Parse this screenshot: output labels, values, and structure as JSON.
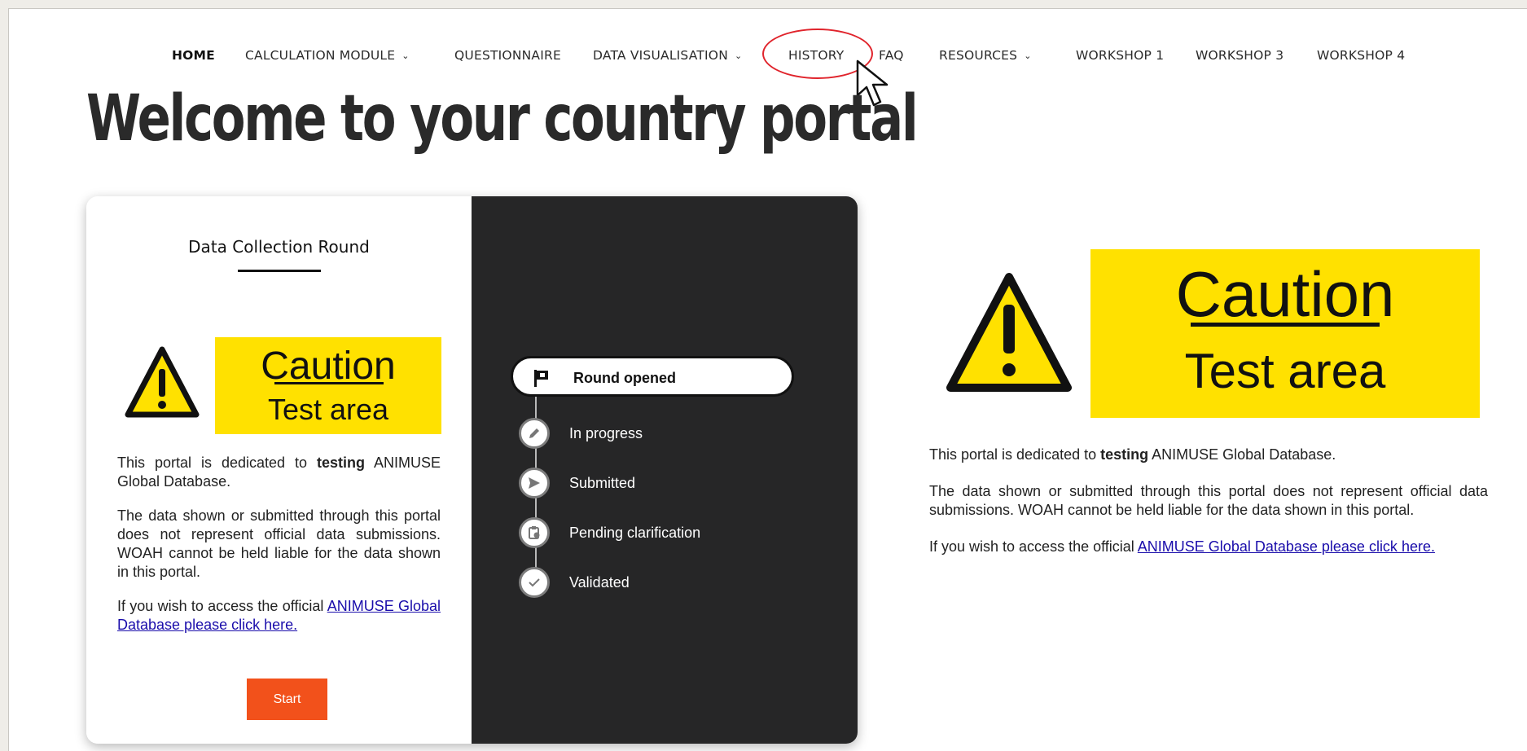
{
  "nav": {
    "items": [
      {
        "label": "HOME",
        "active": true
      },
      {
        "label": "CALCULATION MODULE",
        "has_dropdown": true
      },
      {
        "label": "QUESTIONNAIRE"
      },
      {
        "label": "DATA VISUALISATION",
        "has_dropdown": true
      },
      {
        "label": "HISTORY",
        "highlighted": true
      },
      {
        "label": "FAQ"
      },
      {
        "label": "RESOURCES",
        "has_dropdown": true
      },
      {
        "label": "WORKSHOP 1"
      },
      {
        "label": "WORKSHOP 3"
      },
      {
        "label": "WORKSHOP 4"
      }
    ],
    "dropdown_icon": "chevron-down-icon"
  },
  "page": {
    "title": "Welcome to your country portal"
  },
  "card": {
    "round_title": "Data Collection Round",
    "caution": {
      "heading": "Caution",
      "subheading": "Test area",
      "icon": "warning-triangle-icon"
    },
    "notice": {
      "line1_pre": "This portal is dedicated to ",
      "line1_bold": "testing",
      "line1_post": " ANIMUSE Global Database.",
      "line2": "The data shown or submitted through this portal does not represent official data submissions. WOAH  cannot be held liable for the data shown in this portal.",
      "line3_pre": "If you wish to access the official ",
      "line3_link": "ANIMUSE Global Database please click here."
    },
    "start_label": "Start",
    "timeline": {
      "current": {
        "label": "Round opened",
        "icon": "flag-icon"
      },
      "steps": [
        {
          "label": "In progress",
          "icon": "pencil-icon"
        },
        {
          "label": "Submitted",
          "icon": "send-icon"
        },
        {
          "label": "Pending clarification",
          "icon": "clipboard-clock-icon"
        },
        {
          "label": "Validated",
          "icon": "check-icon"
        }
      ]
    }
  },
  "side": {
    "caution": {
      "heading": "Caution",
      "subheading": "Test area"
    },
    "notice": {
      "line1_pre": "This portal is dedicated to ",
      "line1_bold": "testing",
      "line1_post": " ANIMUSE Global Database.",
      "line2": "The data shown or submitted through this portal does not represent official data submissions. WOAH  cannot be held liable for the data shown in this portal.",
      "line3_pre": "If you wish to access the official ",
      "line3_link": "ANIMUSE Global Database please click here."
    }
  },
  "colors": {
    "accent": "#f2511b",
    "caution_yellow": "#ffe100",
    "dark_panel": "#262627",
    "highlight_ring": "#e0242c",
    "link": "#1a0dab"
  }
}
